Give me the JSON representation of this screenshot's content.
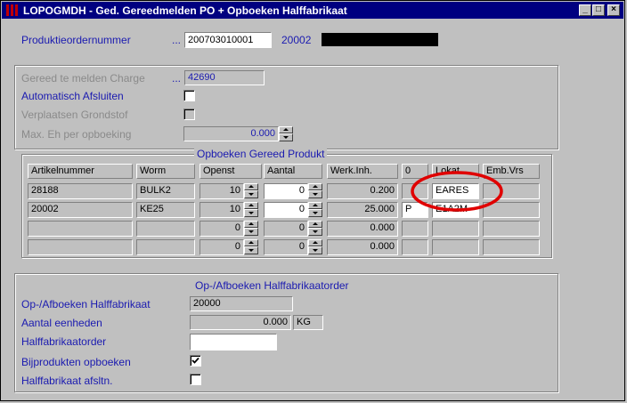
{
  "window": {
    "title": "LOPOGMDH - Ged. Gereedmelden PO + Opboeken Halffabrikaat",
    "minimize_glyph": "_",
    "maximize_glyph": "□",
    "close_glyph": "×"
  },
  "header": {
    "order_label": "Produktieordernummer",
    "ellipsis": "...",
    "order_value": "200703010001",
    "article_code": "20002"
  },
  "charge_section": {
    "charge_label": "Gereed te melden Charge",
    "charge_ellipsis": "...",
    "charge_value": "42690",
    "auto_close_label": "Automatisch Afsluiten",
    "move_raw_label": "Verplaatsen Grondstof",
    "max_units_label": "Max. Eh per opboeking",
    "max_units_value": "0.000"
  },
  "product_group": {
    "title": "Opboeken Gereed Produkt",
    "columns": [
      "Artikelnummer",
      "Worm",
      "Openst",
      "Aantal",
      "Werk.Inh.",
      "0",
      "Lokat",
      "Emb.Vrs"
    ],
    "rows": [
      {
        "artikel": "28188",
        "worm": "BULK2",
        "openst": "10",
        "aantal": "0",
        "werk": "0.200",
        "o": "",
        "lokat": "EARES",
        "emb": ""
      },
      {
        "artikel": "20002",
        "worm": "KE25",
        "openst": "10",
        "aantal": "0",
        "werk": "25.000",
        "o": "P",
        "lokat": "E1A2M",
        "emb": ""
      },
      {
        "artikel": "",
        "worm": "",
        "openst": "0",
        "aantal": "0",
        "werk": "0.000",
        "o": "",
        "lokat": "",
        "emb": ""
      },
      {
        "artikel": "",
        "worm": "",
        "openst": "0",
        "aantal": "0",
        "werk": "0.000",
        "o": "",
        "lokat": "",
        "emb": ""
      }
    ]
  },
  "half_group": {
    "title": "Op-/Afboeken Halffabrikaatorder",
    "item_label": "Op-/Afboeken Halffabrikaat",
    "item_value": "20000",
    "units_label": "Aantal eenheden",
    "units_value": "0.000",
    "unit": "KG",
    "order_label": "Halffabrikaatorder",
    "order_value": "",
    "byproducts_label": "Bijprodukten opboeken",
    "byproducts_checked": true,
    "close_label": "Halffabrikaat afsltn.",
    "close_checked": false
  },
  "colors": {
    "title_bar": "#000080",
    "label_blue": "#1a1ab0",
    "annotation_red": "#e00000"
  }
}
